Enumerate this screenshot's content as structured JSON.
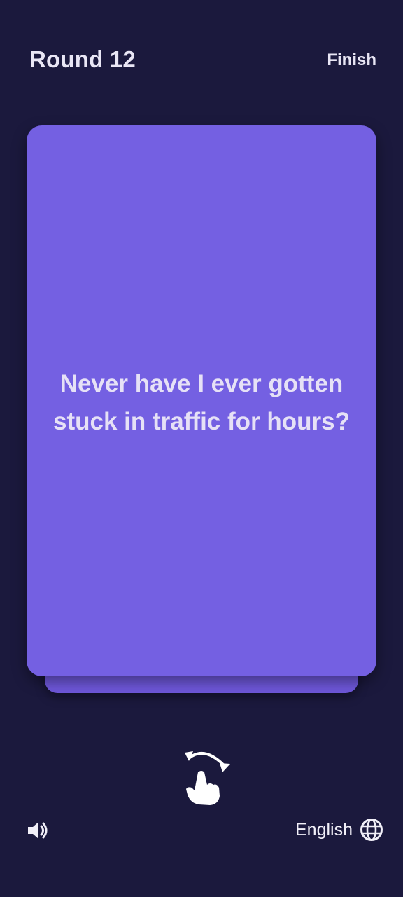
{
  "header": {
    "round_label": "Round 12",
    "finish_label": "Finish"
  },
  "card": {
    "question": "Never have I ever gotten stuck in traffic for hours?"
  },
  "footer": {
    "sound_icon": "speaker-icon",
    "language_label": "English",
    "language_icon": "globe-icon"
  },
  "hint": {
    "icon": "swipe-hand-icon"
  },
  "colors": {
    "background": "#1b193d",
    "card": "#7460e2",
    "card_back": "#6f58dc",
    "text": "#e9e6f5"
  }
}
